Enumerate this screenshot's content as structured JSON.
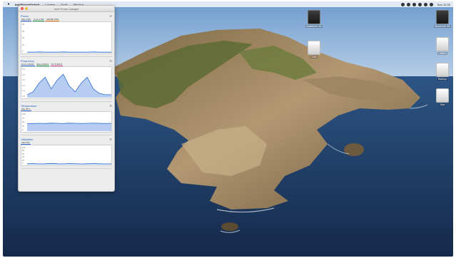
{
  "menubar": {
    "apple_icon": "apple-icon",
    "app_name": "IntelPowerGadget",
    "menus": [
      "Logging",
      "Tools",
      "Window"
    ],
    "status_icons": [
      "battery-icon",
      "wifi-icon",
      "search-icon",
      "control-center-icon",
      "user-icon",
      "siri-icon"
    ],
    "clock": "Sun 12:30"
  },
  "desktop": {
    "icons": [
      {
        "icon": "dark-drive-icon",
        "label": "Macintosh HD"
      },
      {
        "icon": "white-drive-icon",
        "label": "Data"
      },
      {
        "icon": "dark-drive-icon",
        "label": "Macintosh HD"
      },
      {
        "icon": "white-drive-icon",
        "label": "Untitled"
      },
      {
        "icon": "white-drive-icon",
        "label": "Backup"
      },
      {
        "icon": "white-drive-icon",
        "label": "Disk"
      }
    ]
  },
  "widget": {
    "title": "Intel Power Gadget",
    "panels": [
      {
        "name": "Power",
        "legend": [
          "Pkg 3.2W",
          "Core 1.0W",
          "DRAM 0.5W"
        ],
        "legend_colors": [
          "#2f6fd6",
          "#1a9b44",
          "#e07b1f"
        ],
        "yticks": [
          "40",
          "30",
          "20",
          "10",
          "0"
        ],
        "series": [
          0.02,
          0.02,
          0.03,
          0.02,
          0.02,
          0.02,
          0.03,
          0.02,
          0.02,
          0.02,
          0.02,
          0.03,
          0.02,
          0.02,
          0.02
        ]
      },
      {
        "name": "Frequency",
        "legend": [
          "Core 1.2GHz",
          "Req 3.2GHz",
          "GT 0.3GHz"
        ],
        "legend_colors": [
          "#2f6fd6",
          "#1a9b44",
          "#d64b9c"
        ],
        "yticks": [
          "5.0",
          "4.0",
          "3.0",
          "2.0",
          "1.0",
          "0.0"
        ],
        "series": [
          0.1,
          0.2,
          0.5,
          0.7,
          0.3,
          0.6,
          0.8,
          0.4,
          0.2,
          0.5,
          0.7,
          0.3,
          0.15,
          0.1,
          0.1
        ]
      },
      {
        "name": "Temperature",
        "legend": [
          "Pkg 45°C"
        ],
        "legend_colors": [
          "#2f6fd6"
        ],
        "yticks": [
          "100",
          "75",
          "50",
          "25",
          "0"
        ],
        "series": [
          0.42,
          0.43,
          0.44,
          0.43,
          0.45,
          0.44,
          0.43,
          0.45,
          0.44,
          0.43,
          0.44,
          0.45,
          0.44,
          0.43,
          0.44
        ]
      },
      {
        "name": "Utilization",
        "legend": [
          "CPU 5%"
        ],
        "legend_colors": [
          "#2f6fd6"
        ],
        "yticks": [
          "100",
          "80",
          "60",
          "40",
          "20",
          "0"
        ],
        "series": [
          0.05,
          0.06,
          0.04,
          0.05,
          0.07,
          0.05,
          0.04,
          0.06,
          0.05,
          0.04,
          0.05,
          0.06,
          0.05,
          0.04,
          0.05
        ]
      }
    ]
  },
  "colors": {
    "sky": "#8fb3d9",
    "sea": "#1f3c66",
    "rock": "#a88c68",
    "vegetation": "#5d6b34",
    "accent": "#2a63b8"
  }
}
